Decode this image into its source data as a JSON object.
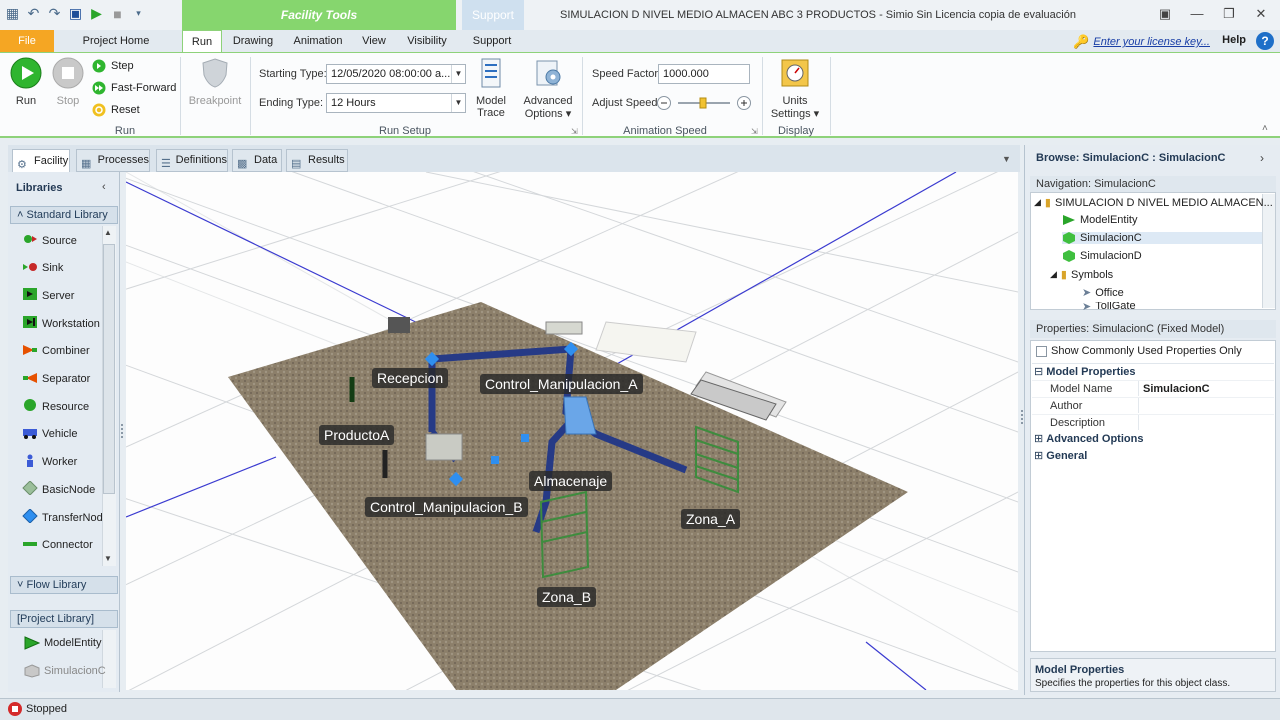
{
  "window": {
    "title": "SIMULACION D NIVEL MEDIO ALMACEN ABC 3 PRODUCTOS - Simio Sin Licencia copia de evaluación",
    "context_tab": "Facility Tools",
    "context_tab_support": "Support"
  },
  "tabs": {
    "file": "File",
    "project_home": "Project Home",
    "run": "Run",
    "drawing": "Drawing",
    "animation": "Animation",
    "view": "View",
    "visibility": "Visibility",
    "support": "Support",
    "license_link": "Enter your license key...",
    "help": "Help"
  },
  "ribbon": {
    "run_group": {
      "run": "Run",
      "stop": "Stop",
      "step": "Step",
      "fast_forward": "Fast-Forward",
      "reset": "Reset",
      "label": "Run"
    },
    "breakpoint": "Breakpoint",
    "run_setup": {
      "starting_type_label": "Starting Type:",
      "starting_type_value": "12/05/2020 08:00:00 a...",
      "ending_type_label": "Ending Type:",
      "ending_type_value": "12 Hours",
      "model_trace": [
        "Model",
        "Trace"
      ],
      "advanced_options": [
        "Advanced",
        "Options ▾"
      ],
      "label": "Run Setup"
    },
    "animation_speed": {
      "speed_factor_label": "Speed Factor:",
      "speed_factor_value": "1000.000",
      "adjust_speed_label": "Adjust Speed:",
      "label": "Animation Speed"
    },
    "display": {
      "units_settings": [
        "Units",
        "Settings ▾"
      ],
      "label": "Display"
    }
  },
  "doc_tabs": [
    "Facility",
    "Processes",
    "Definitions",
    "Data",
    "Results"
  ],
  "libraries": {
    "title": "Libraries",
    "standard": "Standard Library",
    "standard_items": [
      {
        "label": "Source",
        "icon": "source-icon"
      },
      {
        "label": "Sink",
        "icon": "sink-icon"
      },
      {
        "label": "Server",
        "icon": "server-icon"
      },
      {
        "label": "Workstation",
        "icon": "workstation-icon"
      },
      {
        "label": "Combiner",
        "icon": "combiner-icon"
      },
      {
        "label": "Separator",
        "icon": "separator-icon"
      },
      {
        "label": "Resource",
        "icon": "resource-icon"
      },
      {
        "label": "Vehicle",
        "icon": "vehicle-icon"
      },
      {
        "label": "Worker",
        "icon": "worker-icon"
      },
      {
        "label": "BasicNode",
        "icon": "basicnode-icon"
      },
      {
        "label": "TransferNod",
        "icon": "transfernode-icon"
      },
      {
        "label": "Connector",
        "icon": "connector-icon"
      }
    ],
    "flow": "Flow Library",
    "project": "[Project Library]",
    "project_items": [
      "ModelEntity",
      "SimulacionC"
    ]
  },
  "canvas_labels": {
    "recepcion": "Recepcion",
    "control_a": "Control_Manipulacion_A",
    "producto_a": "ProductoA",
    "almacenaje": "Almacenaje",
    "control_b": "Control_Manipulacion_B",
    "zona_a": "Zona_A",
    "zona_b": "Zona_B"
  },
  "browse": {
    "title": "Browse: SimulacionC : SimulacionC",
    "navigation": "Navigation: SimulacionC",
    "tree": {
      "root": "SIMULACION D NIVEL MEDIO ALMACEN...",
      "children": [
        "ModelEntity",
        "SimulacionC",
        "SimulacionD"
      ],
      "symbols": "Symbols",
      "symbol_children": [
        "Office",
        "TollGate"
      ]
    }
  },
  "properties": {
    "title": "Properties: SimulacionC (Fixed Model)",
    "show_common": "Show Commonly Used Properties Only",
    "model_properties": "Model Properties",
    "rows": [
      {
        "name": "Model Name",
        "value": "SimulacionC"
      },
      {
        "name": "Author",
        "value": ""
      },
      {
        "name": "Description",
        "value": ""
      }
    ],
    "advanced_options": "Advanced Options",
    "general": "General",
    "desc_title": "Model Properties",
    "desc_text": "Specifies the properties for this object class."
  },
  "status": {
    "text": "Stopped"
  },
  "colors": {
    "green_accent": "#8ed27a",
    "file_orange": "#f5a623",
    "floor": "#8c7f6a"
  }
}
